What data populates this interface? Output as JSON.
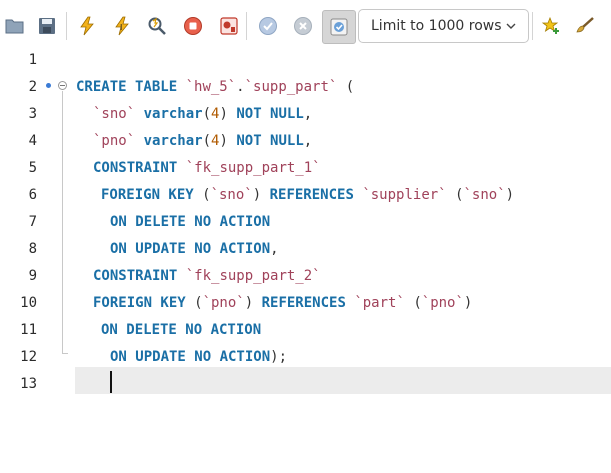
{
  "toolbar": {
    "icons": [
      "open-folder-icon",
      "save-icon",
      "execute-icon",
      "execute-current-icon",
      "explain-icon",
      "stop-icon",
      "toggle-error-icon",
      "commit-icon",
      "rollback-icon",
      "autocommit-icon",
      "bookmark-star-icon",
      "beautify-brush-icon"
    ],
    "limit_label": "Limit to 1000 rows"
  },
  "editor": {
    "line_numbers": [
      "1",
      "2",
      "3",
      "4",
      "5",
      "6",
      "7",
      "8",
      "9",
      "10",
      "11",
      "12",
      "13"
    ],
    "current_line": "13"
  },
  "colors": {
    "keyword": "#1a6fa6",
    "identifier": "#a0425a",
    "number": "#b05a00",
    "current_line_bg": "#ececec"
  },
  "code": {
    "l2": {
      "t1": "CREATE TABLE",
      "t2": " ",
      "t3": "`hw_5`",
      "t4": ".",
      "t5": "`supp_part`",
      "t6": " ("
    },
    "l3": {
      "t1": "`sno`",
      "t2": " ",
      "t3": "varchar",
      "t4": "(",
      "t5": "4",
      "t6": ") ",
      "t7": "NOT NULL",
      "t8": ","
    },
    "l4": {
      "t1": "`pno`",
      "t2": " ",
      "t3": "varchar",
      "t4": "(",
      "t5": "4",
      "t6": ") ",
      "t7": "NOT NULL",
      "t8": ","
    },
    "l5": {
      "t1": "CONSTRAINT",
      "t2": " ",
      "t3": "`fk_supp_part_1`"
    },
    "l6": {
      "t1": "FOREIGN KEY",
      "t2": " (",
      "t3": "`sno`",
      "t4": ") ",
      "t5": "REFERENCES",
      "t6": " ",
      "t7": "`supplier`",
      "t8": " (",
      "t9": "`sno`",
      "t10": ")"
    },
    "l7": {
      "t1": "ON DELETE NO ACTION"
    },
    "l8": {
      "t1": "ON UPDATE NO ACTION",
      "t2": ","
    },
    "l9": {
      "t1": "CONSTRAINT",
      "t2": " ",
      "t3": "`fk_supp_part_2`"
    },
    "l10": {
      "t1": "FOREIGN KEY",
      "t2": " (",
      "t3": "`pno`",
      "t4": ") ",
      "t5": "REFERENCES",
      "t6": " ",
      "t7": "`part`",
      "t8": " (",
      "t9": "`pno`",
      "t10": ")"
    },
    "l11": {
      "t1": "ON DELETE NO ACTION"
    },
    "l12": {
      "t1": "ON UPDATE NO ACTION",
      "t2": ");"
    }
  }
}
